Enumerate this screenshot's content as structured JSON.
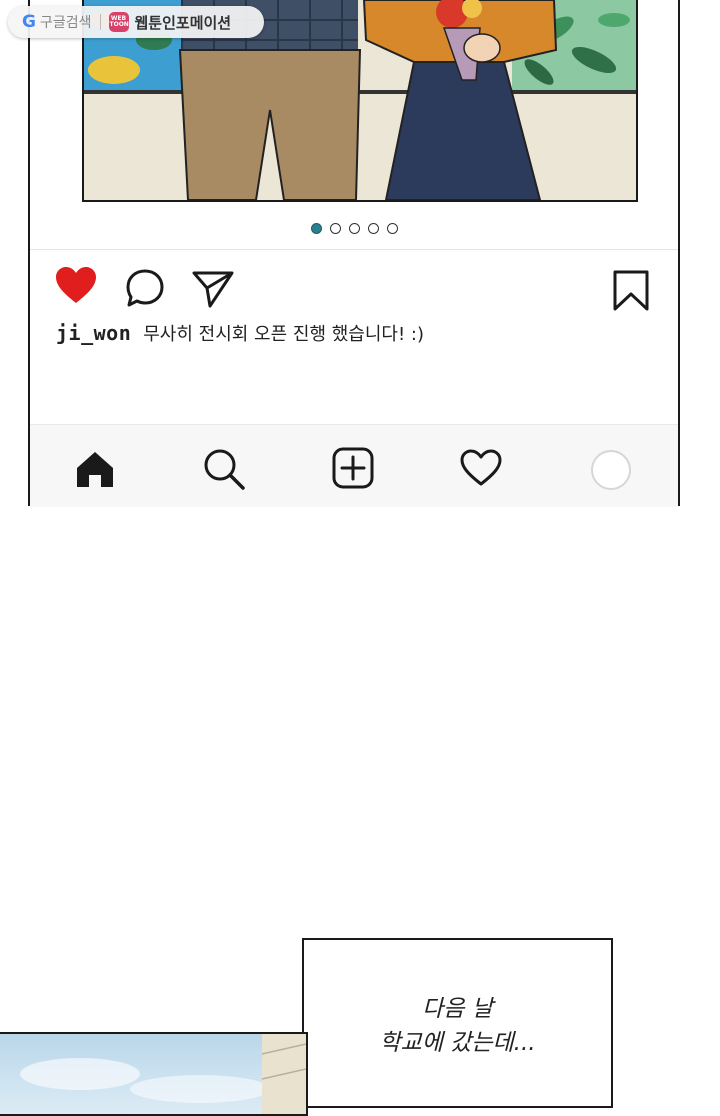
{
  "badge": {
    "google_logo": "G",
    "google_label": "구글검색",
    "webtoon_logo": "WEB TOON",
    "webtoon_label": "웹툰인포메이션"
  },
  "post": {
    "carousel": {
      "total": 5,
      "active": 1
    },
    "actions": {
      "like_icon": "heart-filled-icon",
      "comment_icon": "comment-icon",
      "share_icon": "send-icon",
      "save_icon": "bookmark-icon",
      "like_color": "#e01e1e"
    },
    "username": "ji_won",
    "caption": "무사히 전시회 오픈 진행 했습니다! :)"
  },
  "bottom_nav": [
    "home-icon",
    "search-icon",
    "add-post-icon",
    "activity-heart-icon",
    "profile-avatar"
  ],
  "narration": {
    "line1": "다음 날",
    "line2": "학교에 갔는데..."
  }
}
